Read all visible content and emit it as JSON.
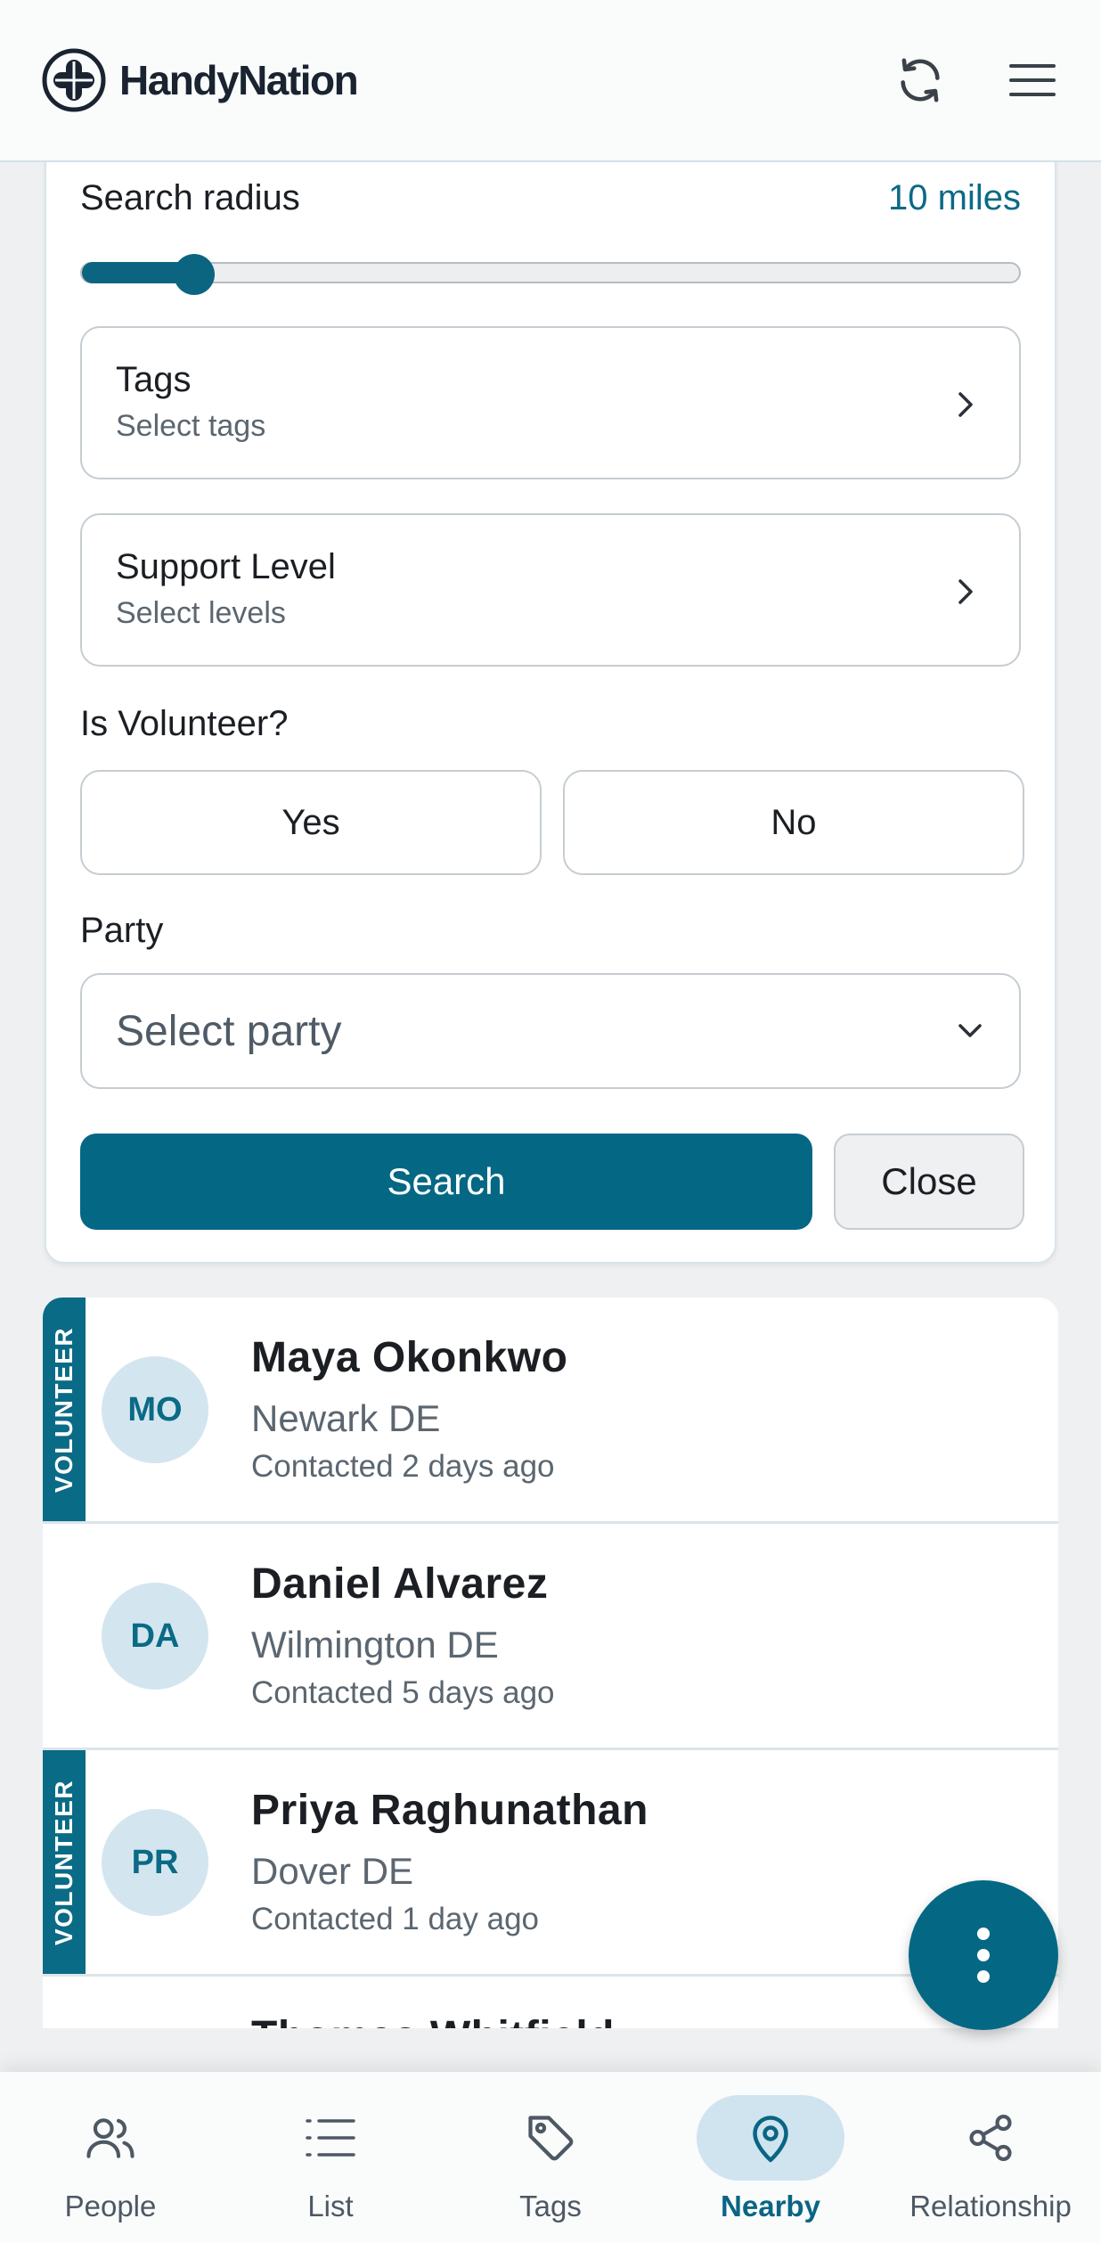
{
  "app": {
    "name": "HandyNation",
    "accent_color": "#046884",
    "icons": {
      "logo": "handynation-logo",
      "refresh": "refresh-icon",
      "menu": "hamburger-menu-icon"
    }
  },
  "filters": {
    "radius_label": "Search radius",
    "radius_value": "10 miles",
    "radius_slider_fraction": 0.12,
    "tags": {
      "title": "Tags",
      "placeholder": "Select tags"
    },
    "support": {
      "title": "Support Level",
      "placeholder": "Select levels"
    },
    "volunteer": {
      "label": "Is Volunteer?",
      "yes": "Yes",
      "no": "No"
    },
    "party": {
      "label": "Party",
      "placeholder": "Select party"
    },
    "search_label": "Search",
    "close_label": "Close"
  },
  "results": [
    {
      "initials": "MO",
      "name": "Maya Okonkwo",
      "location": "Newark DE",
      "contacted": "Contacted 2 days ago",
      "volunteer": true,
      "badge": "VOLUNTEER"
    },
    {
      "initials": "DA",
      "name": "Daniel Alvarez",
      "location": "Wilmington DE",
      "contacted": "Contacted 5 days ago",
      "volunteer": false,
      "badge": ""
    },
    {
      "initials": "PR",
      "name": "Priya Raghunathan",
      "location": "Dover DE",
      "contacted": "Contacted 1 day ago",
      "volunteer": true,
      "badge": "VOLUNTEER"
    },
    {
      "initials": "",
      "name": "Thomas Whitfield",
      "location": "",
      "contacted": "",
      "volunteer": false,
      "badge": ""
    }
  ],
  "fab": {
    "icon": "more-vertical-icon"
  },
  "nav": [
    {
      "label": "People",
      "icon": "people-icon",
      "active": false
    },
    {
      "label": "List",
      "icon": "list-icon",
      "active": false
    },
    {
      "label": "Tags",
      "icon": "tag-icon",
      "active": false
    },
    {
      "label": "Nearby",
      "icon": "location-pin-icon",
      "active": true
    },
    {
      "label": "Relationship",
      "icon": "share-nodes-icon",
      "active": false
    }
  ]
}
